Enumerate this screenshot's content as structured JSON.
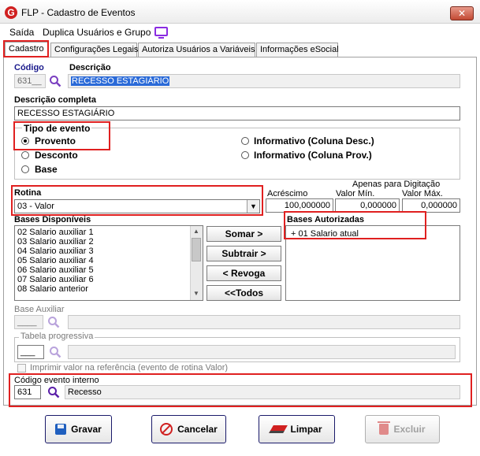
{
  "window": {
    "title": "FLP - Cadastro de Eventos",
    "app_icon_letter": "G",
    "close_glyph": "✕"
  },
  "menu": {
    "items": [
      {
        "label": "Saída"
      },
      {
        "label": "Duplica Usuários e Grupo"
      }
    ]
  },
  "tabs": [
    {
      "label": "Cadastro"
    },
    {
      "label": "Configurações Legais"
    },
    {
      "label": "Autoriza Usuários a Variáveis"
    },
    {
      "label": "Informações eSocial"
    }
  ],
  "form": {
    "codigo_label": "Código",
    "codigo_value": "631__",
    "descricao_label": "Descrição",
    "descricao_value": "RECESSO ESTAGIÁRIO",
    "descricao_completa_label": "Descrição completa",
    "descricao_completa_value": "RECESSO ESTAGIÁRIO",
    "tipo_evento": {
      "label": "Tipo de evento",
      "options": [
        "Provento",
        "Desconto",
        "Base",
        "Informativo (Coluna Desc.)",
        "Informativo (Coluna Prov.)"
      ],
      "selected": "Provento"
    },
    "rotina_label": "Rotina",
    "rotina_value": "03 - Valor",
    "apenas_label": "Apenas para Digitação",
    "acrescimo_label": "Acréscimo",
    "acrescimo_value": "100,000000",
    "valor_min_label": "Valor Mín.",
    "valor_min_value": "0,000000",
    "valor_max_label": "Valor Máx.",
    "valor_max_value": "0,000000",
    "bases_disponiveis_label": "Bases Disponíveis",
    "bases_disponiveis": [
      "02 Salario auxiliar 1",
      "03 Salario auxiliar 2",
      "04 Salario auxiliar 3",
      "05 Salario auxiliar 4",
      "06 Salario auxiliar 5",
      "07 Salario auxiliar 6",
      "08 Salario anterior"
    ],
    "bases_autorizadas_label": "Bases Autorizadas",
    "bases_autorizadas": [
      "+ 01 Salario atual"
    ],
    "buttons": {
      "somar": "Somar >",
      "subtrair": "Subtrair >",
      "revoga": "< Revoga",
      "todos": "<<Todos"
    },
    "base_auxiliar_label": "Base Auxiliar",
    "base_auxiliar_value": "____",
    "tabela_progressiva_label": "Tabela progressiva",
    "tabela_progressiva_value": "___",
    "imprimir_label": "Imprimir valor na referência (evento de rotina Valor)",
    "codigo_interno_label": "Código evento interno",
    "codigo_interno_value": "631",
    "codigo_interno_desc": "Recesso"
  },
  "actions": {
    "gravar": "Gravar",
    "cancelar": "Cancelar",
    "limpar": "Limpar",
    "excluir": "Excluir"
  },
  "colors": {
    "accent_red": "#e02020",
    "selection_blue": "#2a6ad8",
    "icon_purple": "#8a2be2"
  }
}
